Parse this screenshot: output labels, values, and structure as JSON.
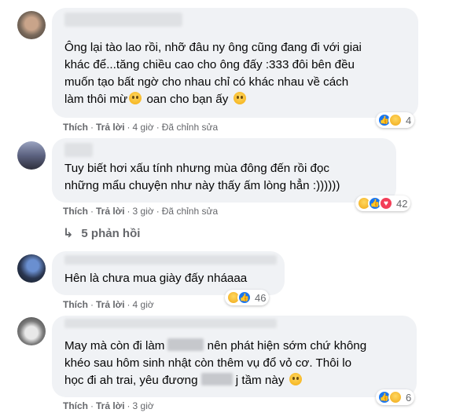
{
  "comments": [
    {
      "text": "Ông lại tào lao rồi, nhỡ đâu ny ông cũng đang đi với giai\nkhác để...tăng chiều cao cho ông đấy :333 đôi bên đều\nmuốn tạo bất ngờ cho nhau chỉ có khác nhau về cách\nlàm thôi mừ",
      "text_tail": " oan cho bạn ấy ",
      "like": "Thích",
      "reply": "Trả lời",
      "time": "4 giờ",
      "edited": "Đã chỉnh sửa",
      "reaction_count": "4",
      "reactions": [
        "like-icon",
        "haha-icon"
      ]
    },
    {
      "text": "Tuy biết hơi xấu tính nhưng mùa đông đến rồi đọc\nnhững mẩu chuyện như này thấy ấm lòng hẳn :))))))",
      "like": "Thích",
      "reply": "Trả lời",
      "time": "3 giờ",
      "edited": "Đã chỉnh sửa",
      "reaction_count": "42",
      "reactions": [
        "haha-icon",
        "like-icon",
        "love-icon"
      ]
    },
    {
      "text": "Hên là chưa mua giày đấy nháaaa",
      "like": "Thích",
      "reply": "Trả lời",
      "time": "4 giờ",
      "reaction_count": "46",
      "reactions": [
        "haha-icon",
        "like-icon"
      ]
    },
    {
      "text_line1": "May mà còn đi làm",
      "text_line1b": " nên phát hiện sớm chứ không",
      "text_line2": "khéo sau hôm sinh nhật còn thêm vụ đổ vỏ cơ. Thôi lo",
      "text_line3a": "học đi ah trai, yêu đương",
      "text_line3b": " j tầm này ",
      "like": "Thích",
      "reply": "Trả lời",
      "time": "3 giờ",
      "reaction_count": "6",
      "reactions": [
        "like-icon",
        "haha-icon"
      ]
    }
  ],
  "replies_link": {
    "arrow": "↳",
    "label": "5 phản hồi"
  }
}
